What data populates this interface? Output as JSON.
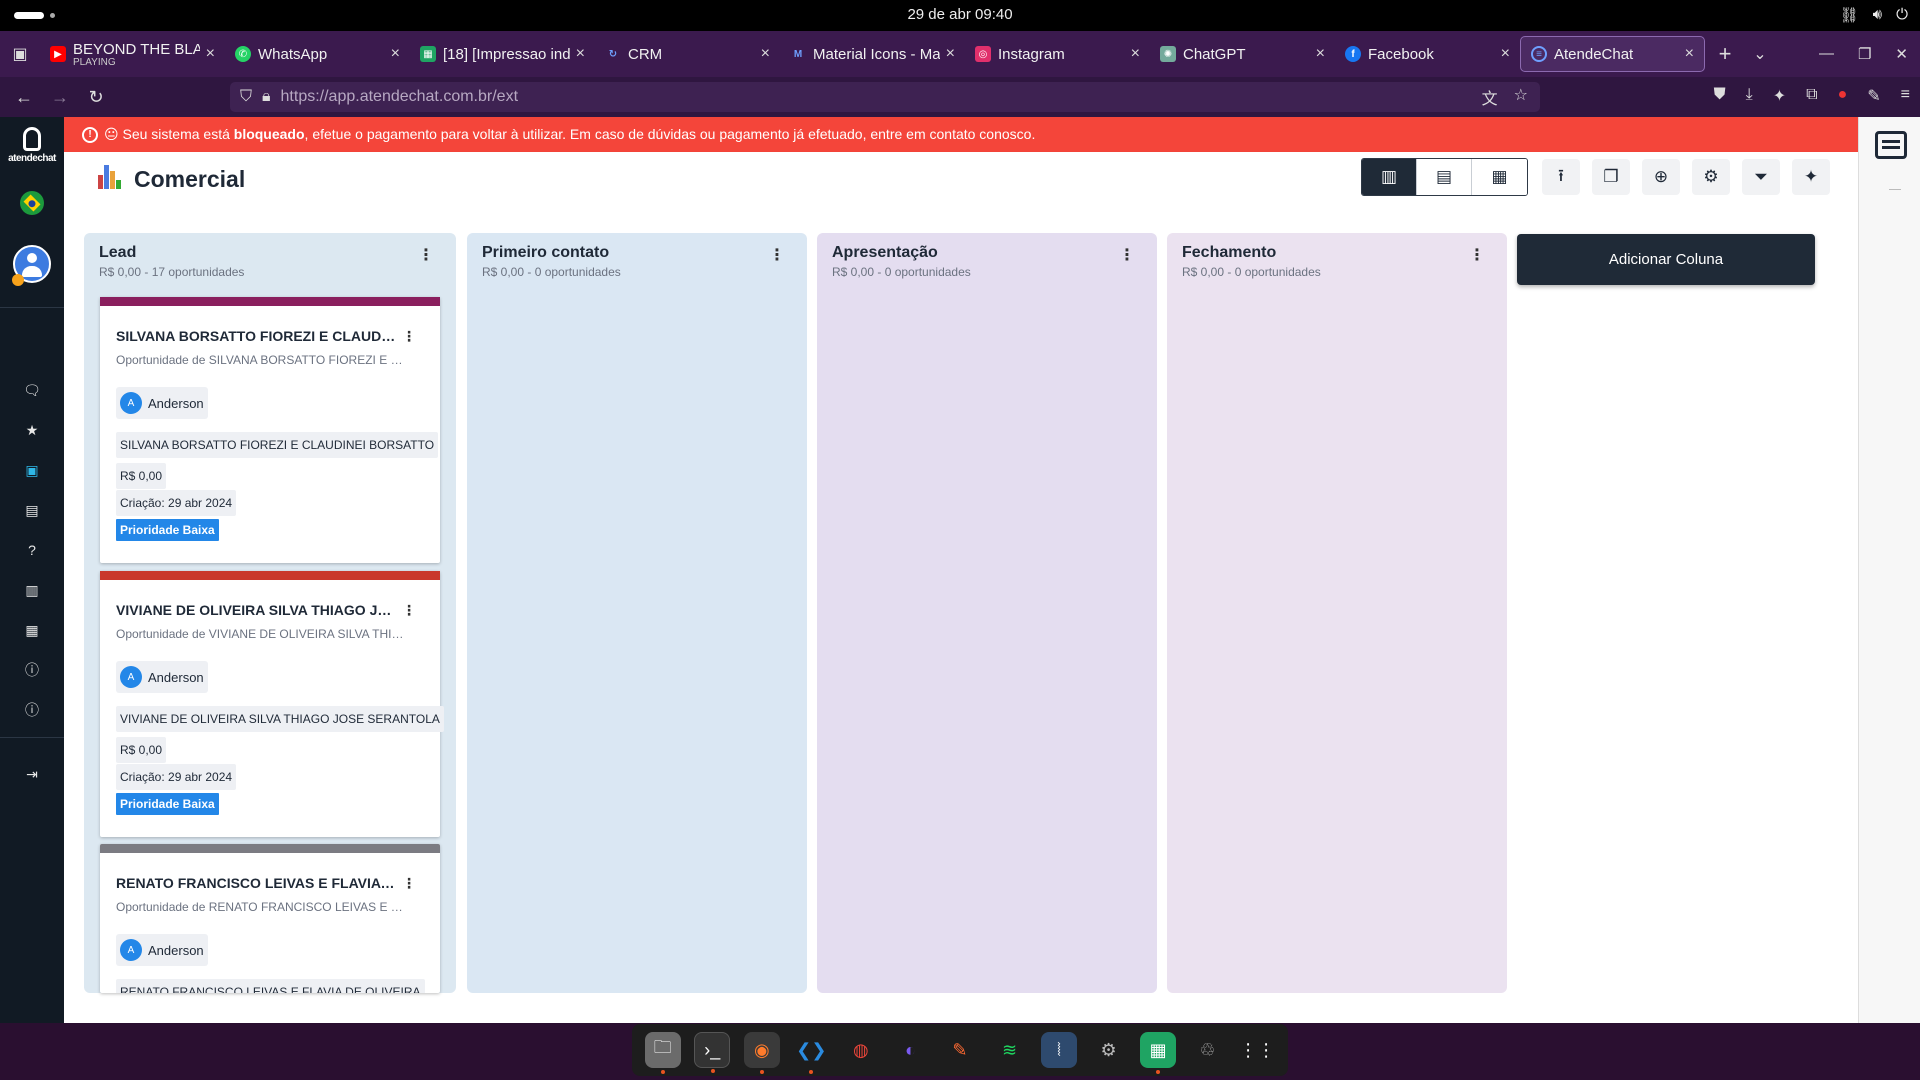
{
  "system": {
    "clock": "29 de abr  09:40",
    "tray_icons": [
      "network-icon",
      "volume-icon",
      "power-icon"
    ]
  },
  "browser": {
    "tabs": [
      {
        "title": "BEYOND THE BLACK",
        "subtitle": "PLAYING",
        "icon": "youtube-icon",
        "color": "#ff0000"
      },
      {
        "title": "WhatsApp",
        "icon": "whatsapp-icon",
        "color": "#25d366"
      },
      {
        "title": "[18] [Impressao ind",
        "icon": "sheets-icon",
        "color": "#1fa463"
      },
      {
        "title": "CRM",
        "icon": "crm-icon",
        "color": "#3d7be0"
      },
      {
        "title": "Material Icons - Mat",
        "icon": "material-icon",
        "color": "#4a7be0"
      },
      {
        "title": "Instagram",
        "icon": "instagram-icon",
        "color": "#e1306c"
      },
      {
        "title": "ChatGPT",
        "icon": "chatgpt-icon",
        "color": "#74aa9c"
      },
      {
        "title": "Facebook",
        "icon": "facebook-icon",
        "color": "#1877f2"
      },
      {
        "title": "AtendeChat",
        "icon": "atendechat-icon",
        "color": "#3d7be0",
        "active": true
      }
    ],
    "url": "https://app.atendechat.com.br/ext"
  },
  "alert": {
    "pre": "😐 Seu sistema está ",
    "bold": "bloqueado",
    "post": ", efetue o pagamento para voltar à utilizar. Em caso de dúvidas ou pagamento já efetuado, entre em contato conosco."
  },
  "sidebar": {
    "brand": "atendechat"
  },
  "header": {
    "title": "Comercial"
  },
  "board": {
    "add_column_label": "Adicionar Coluna",
    "columns": [
      {
        "title": "Lead",
        "summary": "R$ 0,00 - 17 oportunidades",
        "bg": "#dce8f1"
      },
      {
        "title": "Primeiro contato",
        "summary": "R$ 0,00 - 0 oportunidades",
        "bg": "#dae7f3"
      },
      {
        "title": "Apresentação",
        "summary": "R$ 0,00 - 0 oportunidades",
        "bg": "#e4ddf0"
      },
      {
        "title": "Fechamento",
        "summary": "R$ 0,00 - 0 oportunidades",
        "bg": "#ebe2f0"
      }
    ],
    "cards": [
      {
        "title": "SILVANA BORSATTO FIOREZI E CLAUDINEI BORSATTO",
        "subtitle": "Oportunidade de SILVANA BORSATTO FIOREZI E CLAUDINEI BORSATTO",
        "owner_initial": "A",
        "owner": "Anderson",
        "contact": "SILVANA BORSATTO FIOREZI E CLAUDINEI BORSATTO",
        "value": "R$ 0,00",
        "created": "Criação: 29 abr 2024",
        "priority": "Prioridade Baixa",
        "color": "#8a1f5e"
      },
      {
        "title": "VIVIANE DE OLIVEIRA SILVA THIAGO JOSE SERANTOLA",
        "subtitle": "Oportunidade de VIVIANE DE OLIVEIRA SILVA THIAGO JOSE SERANTOLA",
        "owner_initial": "A",
        "owner": "Anderson",
        "contact": "VIVIANE DE OLIVEIRA SILVA THIAGO JOSE SERANTOLA",
        "value": "R$ 0,00",
        "created": "Criação: 29 abr 2024",
        "priority": "Prioridade Baixa",
        "color": "#c9382c"
      },
      {
        "title": "RENATO FRANCISCO LEIVAS E FLAVIA DE OLIVEIRA",
        "subtitle": "Oportunidade de RENATO FRANCISCO LEIVAS E FLAVIA DE OLIVEIRA",
        "owner_initial": "A",
        "owner": "Anderson",
        "contact": "RENATO FRANCISCO LEIVAS E FLAVIA DE OLIVEIRA",
        "color": "#7b7b82"
      }
    ]
  }
}
